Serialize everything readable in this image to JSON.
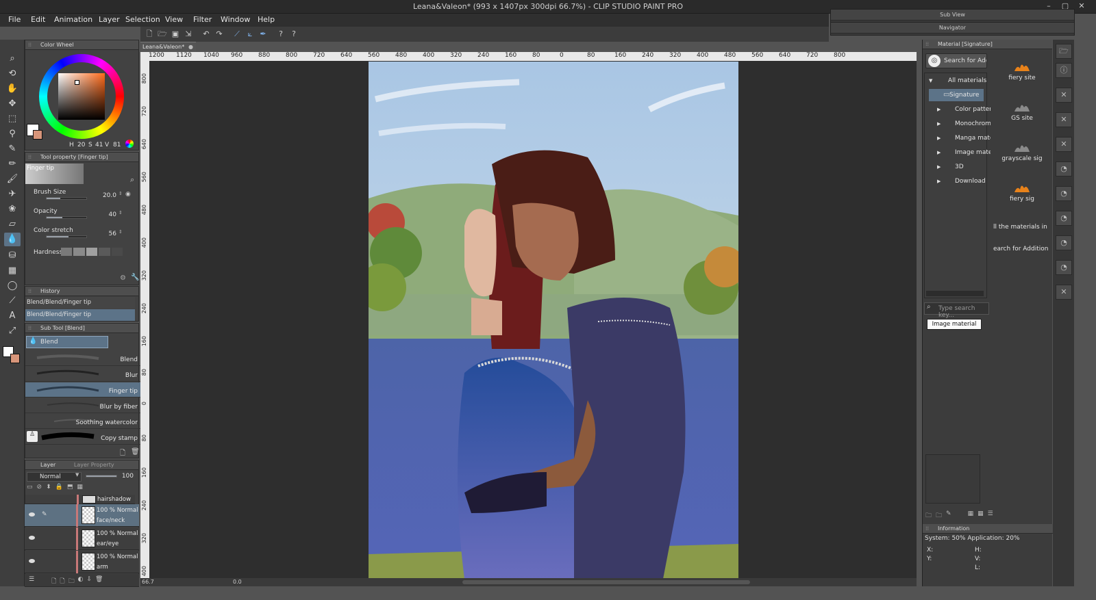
{
  "app": {
    "title": "Leana&Valeon* (993 x 1407px 300dpi 66.7%)  - CLIP STUDIO PAINT PRO",
    "window_buttons": [
      "–",
      "▢",
      "✕"
    ]
  },
  "menu": [
    "File",
    "Edit",
    "Animation",
    "Layer",
    "Selection",
    "View",
    "Filter",
    "Window",
    "Help"
  ],
  "floating": {
    "sub_view": "Sub View",
    "navigator": "Navigator"
  },
  "document_tab": "Leana&Valeon*",
  "ruler_top": [
    "1200",
    "1120",
    "1040",
    "960",
    "880",
    "800",
    "720",
    "640",
    "560",
    "480",
    "400",
    "320",
    "240",
    "160",
    "80",
    "0",
    "80",
    "160",
    "240",
    "320",
    "400",
    "480",
    "560",
    "640",
    "720",
    "800"
  ],
  "ruler_left": [
    "800",
    "720",
    "640",
    "560",
    "480",
    "400",
    "320",
    "240",
    "160",
    "80",
    "0",
    "80",
    "160",
    "240",
    "320",
    "400"
  ],
  "color_wheel": {
    "title": "Color Wheel",
    "h_label": "H",
    "h": "20",
    "s_label": "S",
    "s": "41",
    "v_label": "V",
    "v": "81"
  },
  "tool_property": {
    "title": "Tool property [Finger tip]",
    "preset": "Finger tip",
    "brush_size_label": "Brush Size",
    "brush_size": "20.0",
    "brush_size_level": 0.35,
    "opacity_label": "Opacity",
    "opacity": "40",
    "opacity_level": 0.4,
    "color_stretch_label": "Color stretch",
    "color_stretch": "56",
    "color_stretch_level": 0.56,
    "hardness_label": "Hardness"
  },
  "history": {
    "title": "History",
    "items": [
      "Blend/Blend/Finger tip",
      "Blend/Blend/Finger tip"
    ]
  },
  "sub_tool": {
    "title": "Sub Tool [Blend]",
    "group": "Blend",
    "items": [
      "Blend",
      "Blur",
      "Finger tip",
      "Blur by fiber",
      "Soothing watercolor",
      "Copy stamp"
    ]
  },
  "layer_panel": {
    "tab_layer": "Layer",
    "tab_property": "Layer Property",
    "blend_mode": "Normal",
    "opacity": "100",
    "top_layer": "hairshadow",
    "layers": [
      {
        "mode": "100 % Normal",
        "name": "face/neck"
      },
      {
        "mode": "100 % Normal",
        "name": "ear/eye"
      },
      {
        "mode": "100 % Normal",
        "name": "arm"
      }
    ]
  },
  "statusbar": {
    "zoom": "66.7",
    "angle": "0.0"
  },
  "material": {
    "title": "Material [Signature]",
    "search_button": "Search for Addi...",
    "tree": [
      {
        "label": "All materials",
        "indent": 0
      },
      {
        "label": "Signature",
        "indent": 1
      },
      {
        "label": "Color pattern",
        "indent": 1
      },
      {
        "label": "Monochrome",
        "indent": 1
      },
      {
        "label": "Manga mate",
        "indent": 1
      },
      {
        "label": "Image materi",
        "indent": 1
      },
      {
        "label": "3D",
        "indent": 1
      },
      {
        "label": "Download",
        "indent": 1
      }
    ],
    "items": [
      {
        "name": "fiery site"
      },
      {
        "name": "GS site"
      },
      {
        "name": "grayscale sig"
      },
      {
        "name": "fiery sig"
      }
    ],
    "note_all": "ll the materials in the",
    "note_search": "earch for Additional",
    "search_placeholder": "Type search key...",
    "tag": "Image material"
  },
  "information": {
    "title": "Information",
    "system": "System: 50% Application: 20%",
    "x": "X:",
    "y": "Y:",
    "h": "H:",
    "v": "V:",
    "l": "L:"
  },
  "colors": {
    "main": "#ffffff",
    "sub": "#d7957a",
    "selection": "#5c7388",
    "accent": "#6f8aa3"
  }
}
